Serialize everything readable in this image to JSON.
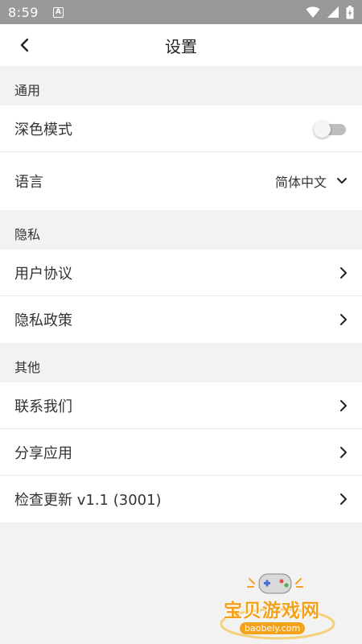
{
  "status_bar": {
    "time": "8:59",
    "notification_letter": "A"
  },
  "header": {
    "title": "设置"
  },
  "sections": {
    "general": {
      "title": "通用",
      "dark_mode": {
        "label": "深色模式",
        "enabled": false
      },
      "language": {
        "label": "语言",
        "value": "简体中文"
      }
    },
    "privacy": {
      "title": "隐私",
      "user_agreement": "用户协议",
      "privacy_policy": "隐私政策"
    },
    "other": {
      "title": "其他",
      "contact_us": "联系我们",
      "share_app": "分享应用",
      "check_update": "检查更新 v1.1 (3001)"
    }
  },
  "watermark": {
    "text": "宝贝游戏网",
    "url": "baobeiy.com"
  },
  "colors": {
    "status_bar": "#999999",
    "background": "#f2f2f2",
    "toggle_off": "#bdbdbd",
    "watermark": "#f3a21b"
  }
}
